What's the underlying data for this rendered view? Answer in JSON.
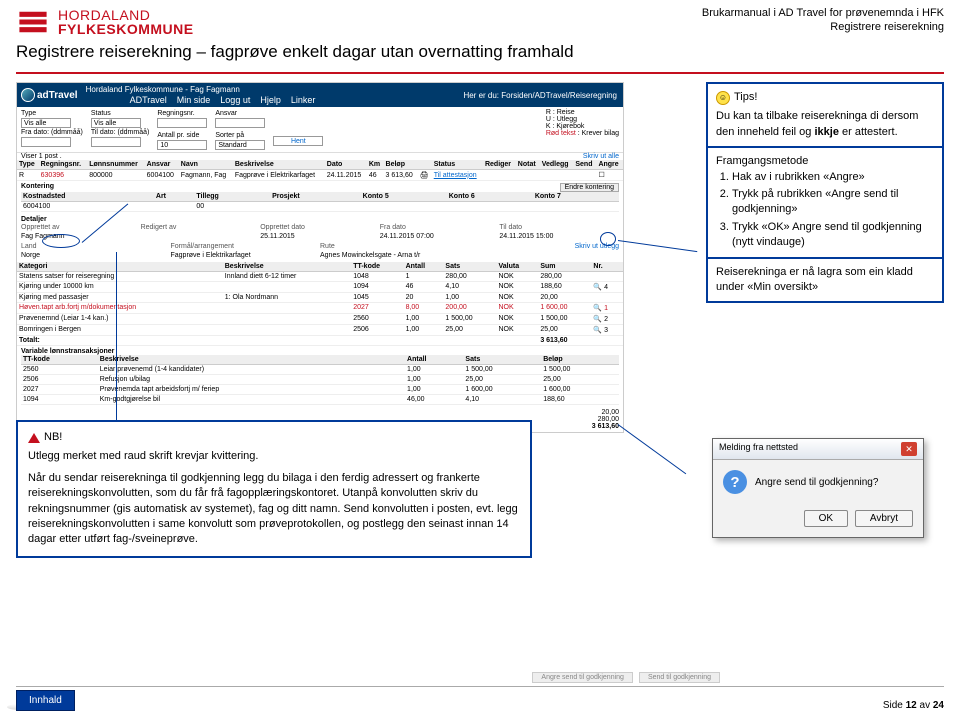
{
  "header": {
    "logo_line1": "HORDALAND",
    "logo_line2": "FYLKESKOMMUNE",
    "brukermanual1": "Brukarmanual i AD Travel for prøvenemnda i HFK",
    "brukermanual2": "Registrere reiserekning",
    "title": "Registrere reiserekning – fagprøve enkelt dagar utan overnatting framhald"
  },
  "app": {
    "logo": "adTravel",
    "org": "Hordaland Fylkeskommune - Fag Fagmann",
    "breadcrumb": "Her er du: Forsiden/ADTravel/Reiseregning",
    "nav": [
      "ADTravel",
      "Min side",
      "Logg ut",
      "Hjelp",
      "Linker"
    ]
  },
  "filters": {
    "type_lbl": "Type",
    "type_val": "Vis alle",
    "status_lbl": "Status",
    "status_val": "Vis alle",
    "regnr_lbl": "Regningsnr.",
    "ansv_lbl": "Ansvar",
    "fra_lbl": "Fra dato: (ddmmåå)",
    "til_lbl": "Til dato: (ddmmåå)",
    "antall_lbl": "Antall pr. side",
    "antall_val": "10",
    "sorter_lbl": "Sorter på",
    "sorter_val": "Standard",
    "hent": "Hent",
    "viser": "Viser 1 post .",
    "r": "R",
    "r_desc": "Reise",
    "u": "U",
    "u_desc": "Utlegg",
    "k": "K",
    "k_desc": "Kjørebok",
    "rod": "Rød tekst",
    "rod_desc": "Krever bilag",
    "skriv_ut": "Skriv ut alle"
  },
  "row_header": [
    "Type",
    "Regningsnr.",
    "Lønnsnummer",
    "Ansvar",
    "Navn",
    "Beskrivelse",
    "Dato",
    "Km",
    "Beløp",
    "",
    "Status",
    "Rediger",
    "Notat",
    "Vedlegg",
    "Send",
    "Angre"
  ],
  "row": [
    "R",
    "630396",
    "800000",
    "6004100",
    "Fagmann, Fag",
    "Fagprøve i Elektrikarfaget",
    "24.11.2015",
    "46",
    "3 613,60",
    "",
    "Til attestasjon",
    "",
    "",
    "",
    "",
    ""
  ],
  "kontering": {
    "title": "Kontering",
    "headers": [
      "Kostnadsted",
      "Art",
      "Tillegg",
      "Prosjekt",
      "Konto 5",
      "Konto 6",
      "Konto 7"
    ],
    "row": [
      "6004100",
      "",
      "00",
      "",
      "",
      "",
      ""
    ],
    "endre": "Endre kontering"
  },
  "detaljer": {
    "title": "Detaljer",
    "opprettet_av_lbl": "Opprettet av",
    "opprettet_av": "Fag Fagmann",
    "redigert_av_lbl": "Redigert av",
    "opprettet_dato_lbl": "Opprettet dato",
    "opprettet_dato": "25.11.2015",
    "fra_dato_lbl": "Fra dato",
    "fra_dato": "24.11.2015 07:00",
    "til_dato_lbl": "Til dato",
    "til_dato": "24.11.2015 15:00",
    "land_lbl": "Land",
    "land": "Norge",
    "formal_lbl": "Formål/arrangement",
    "formal": "Fagprøve i Elektrikarfaget",
    "rute_lbl": "Rute",
    "rute": "Agnes Mowinckelsgate - Arna t/r",
    "skriv_ut_utlegg": "Skriv ut utlegg"
  },
  "kategori": {
    "headers": [
      "Kategori",
      "Beskrivelse",
      "TT-kode",
      "Antall",
      "Sats",
      "Valuta",
      "Sum",
      "Nr."
    ],
    "rows": [
      [
        "Statens satser for reiseregning",
        "Innland diett 6-12 timer",
        "1048",
        "1",
        "280,00",
        "NOK",
        "280,00",
        ""
      ],
      [
        "Kjøring under 10000 km",
        "",
        "1094",
        "46",
        "4,10",
        "NOK",
        "188,60",
        "4"
      ],
      [
        "Kjøring med passasjer",
        "1: Ola Nordmann",
        "1045",
        "20",
        "1,00",
        "NOK",
        "20,00",
        ""
      ],
      [
        "Høven.tapt arb.fortj m/dokumentasjon",
        "",
        "2027",
        "8,00",
        "200,00",
        "NOK",
        "1 600,00",
        "1"
      ],
      [
        "Prøvenemnd (Leiar 1-4 kan.)",
        "",
        "2560",
        "1,00",
        "1 500,00",
        "NOK",
        "1 500,00",
        "2"
      ],
      [
        "Bomringen i Bergen",
        "",
        "2506",
        "1,00",
        "25,00",
        "NOK",
        "25,00",
        "3"
      ]
    ],
    "totalt_lbl": "Totalt:",
    "totalt_val": "3 613,60"
  },
  "variable": {
    "title": "Variable lønnstransaksjoner",
    "headers": [
      "TT-kode",
      "Beskrivelse",
      "Antall",
      "Sats",
      "Beløp"
    ],
    "rows": [
      [
        "2560",
        "Leiar prøvenemd (1-4 kandidater)",
        "1,00",
        "1 500,00",
        "1 500,00"
      ],
      [
        "2506",
        "Refusjon u/bilag",
        "1,00",
        "25,00",
        "25,00"
      ],
      [
        "2027",
        "Prøvenemda tapt arbeidsfortj m/ feriep",
        "1,00",
        "1 600,00",
        "1 600,00"
      ],
      [
        "1094",
        "Km-godtgjørelse bil",
        "46,00",
        "4,10",
        "188,60"
      ]
    ]
  },
  "totals": [
    "20,00",
    "280,00",
    "3 613,60"
  ],
  "tips": {
    "head": "Tips!",
    "intro": "Du kan ta tilbake reiserekninga di dersom den inneheld feil og ",
    "intro_bold": "ikkje",
    "intro_end": " er attestert.",
    "method": "Framgangsmetode",
    "li1": "Hak av i rubrikken «Angre»",
    "li2": "Trykk på rubrikken «Angre send til godkjenning»",
    "li3": "Trykk «OK» Angre send til godkjenning (nytt vindauge)",
    "result": "Reiserekninga er nå lagra som ein kladd under «Min oversikt»"
  },
  "nb": {
    "head": "NB!",
    "line1": "Utlegg merket med raud skrift krevjar kvittering.",
    "para": "Når du sendar reiserekninga til godkjenning legg du bilaga i den ferdig adressert og frankerte reiserekningskonvolutten, som du får frå fagopplæringskontoret. Utanpå konvolutten skriv du rekningsnummer (gis automatisk av systemet), fag og ditt namn. Send konvolutten i posten, evt. legg reiserekningskonvolutten i same konvolutt som prøveprotokollen, og postlegg den seinast innan 14 dagar etter utført fag-/sveineprøve."
  },
  "dialog": {
    "title": "Melding fra nettsted",
    "msg": "Angre send til godkjenning?",
    "ok": "OK",
    "cancel": "Avbryt"
  },
  "footer": {
    "innhald": "Innhald",
    "page": "Side 12 av 24",
    "angre_btn": "Angre send til godkjenning",
    "send_btn": "Send til godkjenning"
  }
}
